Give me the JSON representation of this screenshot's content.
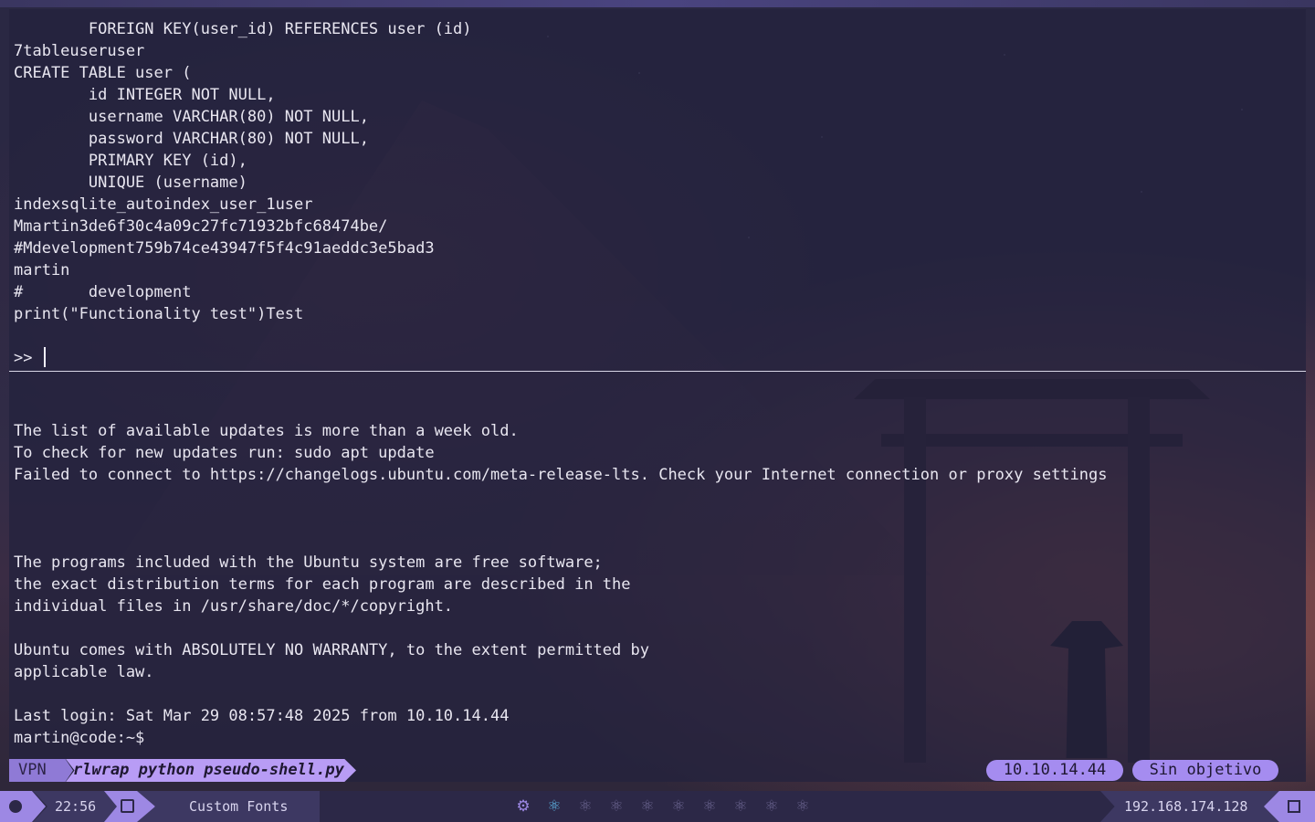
{
  "terminal": {
    "top_pane_lines": [
      "        FOREIGN KEY(user_id) REFERENCES user (id)",
      "7tableuseruser",
      "CREATE TABLE user (",
      "        id INTEGER NOT NULL,",
      "        username VARCHAR(80) NOT NULL,",
      "        password VARCHAR(80) NOT NULL,",
      "        PRIMARY KEY (id),",
      "        UNIQUE (username)",
      "indexsqlite_autoindex_user_1user",
      "Mmartin3de6f30c4a09c27fc71932bfc68474be/",
      "#Mdevelopment759b74ce43947f5f4c91aeddc3e5bad3",
      "martin",
      "#       development",
      "print(\"Functionality test\")Test"
    ],
    "top_prompt": ">> ",
    "bottom_pane_lines": [
      "The list of available updates is more than a week old.",
      "To check for new updates run: sudo apt update",
      "Failed to connect to https://changelogs.ubuntu.com/meta-release-lts. Check your Internet connection or proxy settings",
      "",
      "",
      "",
      "The programs included with the Ubuntu system are free software;",
      "the exact distribution terms for each program are described in the",
      "individual files in /usr/share/doc/*/copyright.",
      "",
      "Ubuntu comes with ABSOLUTELY NO WARRANTY, to the extent permitted by",
      "applicable law.",
      "",
      "Last login: Sat Mar 29 08:57:48 2025 from 10.10.14.44"
    ],
    "shell_prompt": "martin@code:~$"
  },
  "statusline": {
    "vpn_label": "VPN",
    "command": "rlwrap python pseudo-shell.py",
    "vpn_ip": "10.10.14.44",
    "target": "Sin objetivo"
  },
  "bar": {
    "time": "22:56",
    "fonts_label": "Custom Fonts",
    "workspaces": [
      "⚙",
      "⚛",
      "⚛",
      "⚛",
      "⚛",
      "⚛",
      "⚛",
      "⚛",
      "⚛",
      "⚛"
    ],
    "local_ip": "192.168.174.128",
    "colors": {
      "accent": "#9d88e4",
      "active_workspace": "#5fb8e8"
    }
  }
}
